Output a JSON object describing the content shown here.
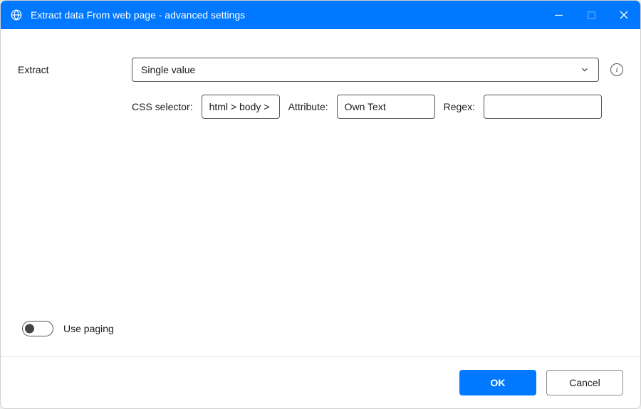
{
  "window": {
    "title": "Extract data From web page - advanced settings"
  },
  "form": {
    "extract_label": "Extract",
    "extract_value": "Single value",
    "css_selector_label": "CSS selector:",
    "css_selector_value": "html > body >",
    "attribute_label": "Attribute:",
    "attribute_value": "Own Text",
    "regex_label": "Regex:",
    "regex_value": ""
  },
  "paging": {
    "label": "Use paging",
    "enabled": false
  },
  "footer": {
    "ok_label": "OK",
    "cancel_label": "Cancel"
  }
}
